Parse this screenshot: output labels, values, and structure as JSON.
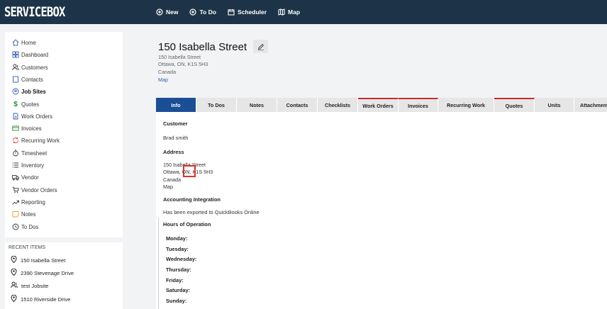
{
  "brand": "SERVICEBOX",
  "topnav": [
    {
      "label": "New",
      "icon": "plus-circle-icon"
    },
    {
      "label": "To Do",
      "icon": "plus-circle-icon"
    },
    {
      "label": "Scheduler",
      "icon": "calendar-icon"
    },
    {
      "label": "Map",
      "icon": "map-icon"
    }
  ],
  "sidebar": {
    "items": [
      {
        "label": "Home",
        "icon": "home-icon"
      },
      {
        "label": "Dashboard",
        "icon": "dashboard-icon"
      },
      {
        "label": "Customers",
        "icon": "customers-icon"
      },
      {
        "label": "Contacts",
        "icon": "contacts-icon"
      },
      {
        "label": "Job Sites",
        "icon": "location-pin-icon"
      },
      {
        "label": "Quotes",
        "icon": "dollar-icon"
      },
      {
        "label": "Work Orders",
        "icon": "work-orders-icon"
      },
      {
        "label": "Invoices",
        "icon": "invoice-icon"
      },
      {
        "label": "Recurring Work",
        "icon": "recurring-icon"
      },
      {
        "label": "Timesheet",
        "icon": "stopwatch-icon"
      },
      {
        "label": "Inventory",
        "icon": "list-icon"
      },
      {
        "label": "Vendor",
        "icon": "truck-icon"
      },
      {
        "label": "Vendor Orders",
        "icon": "cart-icon"
      },
      {
        "label": "Reporting",
        "icon": "chart-trend-icon"
      },
      {
        "label": "Notes",
        "icon": "note-icon"
      },
      {
        "label": "To Dos",
        "icon": "clock-icon"
      }
    ]
  },
  "recent": {
    "title": "RECENT ITEMS",
    "items": [
      {
        "label": "150 Isabella Street",
        "icon": "location-pin-icon"
      },
      {
        "label": "2390 Stevenage Drive",
        "icon": "location-pin-icon"
      },
      {
        "label": "test Jobsite",
        "icon": "customers-icon"
      },
      {
        "label": "1510 Riverside Drive",
        "icon": "location-pin-icon"
      }
    ]
  },
  "header": {
    "title": "150 Isabella Street",
    "address1": "150 Isabella Street",
    "address2": "Ottawa, ON, K1S 5H3",
    "country": "Canada",
    "map_link": "Map"
  },
  "tabs": [
    {
      "label": "Info",
      "active": true
    },
    {
      "label": "To Dos"
    },
    {
      "label": "Notes"
    },
    {
      "label": "Contacts"
    },
    {
      "label": "Checklists"
    },
    {
      "label": "Work Orders",
      "marked": true
    },
    {
      "label": "Invoices",
      "marked": true
    },
    {
      "label": "Recurring Work"
    },
    {
      "label": "Quotes",
      "marked": true
    },
    {
      "label": "Units"
    },
    {
      "label": "Attachments"
    }
  ],
  "info": {
    "customer_label": "Customer",
    "customer_name": "Brad smith",
    "address_label": "Address",
    "address1": "150 Isabella Street",
    "address2": "Ottawa, ON, K1S 5H3",
    "country": "Canada",
    "map_link": "Map",
    "accounting_label": "Accounting Integration",
    "accounting_status": "Has been exported to QuickBooks Online",
    "hours_label": "Hours of Operation",
    "days": [
      "Monday:",
      "Tuesday:",
      "Wednesday:",
      "Thursday:",
      "Friday:",
      "Saturday:",
      "Sunday:"
    ]
  },
  "colors": {
    "topbar": "#1d3448",
    "active_tab": "#1a4f95",
    "link": "#2f5fb0",
    "tab_marker": "#c62d2d",
    "highlight": "#e0302a"
  }
}
